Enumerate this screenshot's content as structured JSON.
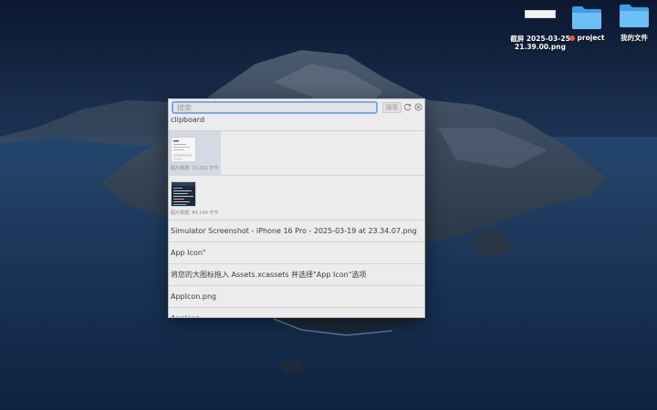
{
  "desktop": {
    "icons": [
      {
        "label_line1": "截屏 2025-03-25",
        "label_line2": "21.39.00.png"
      },
      {
        "label": "project",
        "tag_color": "#ff4d4d"
      },
      {
        "label": "我的文件"
      }
    ],
    "folder_color": "#5fb4f0"
  },
  "clipboard_window": {
    "search": {
      "placeholder": "搜索",
      "value": ""
    },
    "search_button_label": "搜索",
    "header_label": "clipboard",
    "items": [
      {
        "type": "image",
        "caption": "图片数据: 72,282 字节",
        "selected": true
      },
      {
        "type": "image",
        "caption": "图片数据: 84,149 字节",
        "selected": false
      },
      {
        "type": "text",
        "text": "Simulator Screenshot - iPhone 16 Pro - 2025-03-19 at 23.34.07.png"
      },
      {
        "type": "text",
        "text": "App Icon\""
      },
      {
        "type": "text",
        "text": "将您的大图标拖入 Assets.xcassets 并选择\"App Icon\"选项"
      },
      {
        "type": "text",
        "text": "AppIcon.png"
      },
      {
        "type": "text",
        "text": "AppIcon"
      }
    ],
    "accent_color": "#7aa8f0"
  }
}
